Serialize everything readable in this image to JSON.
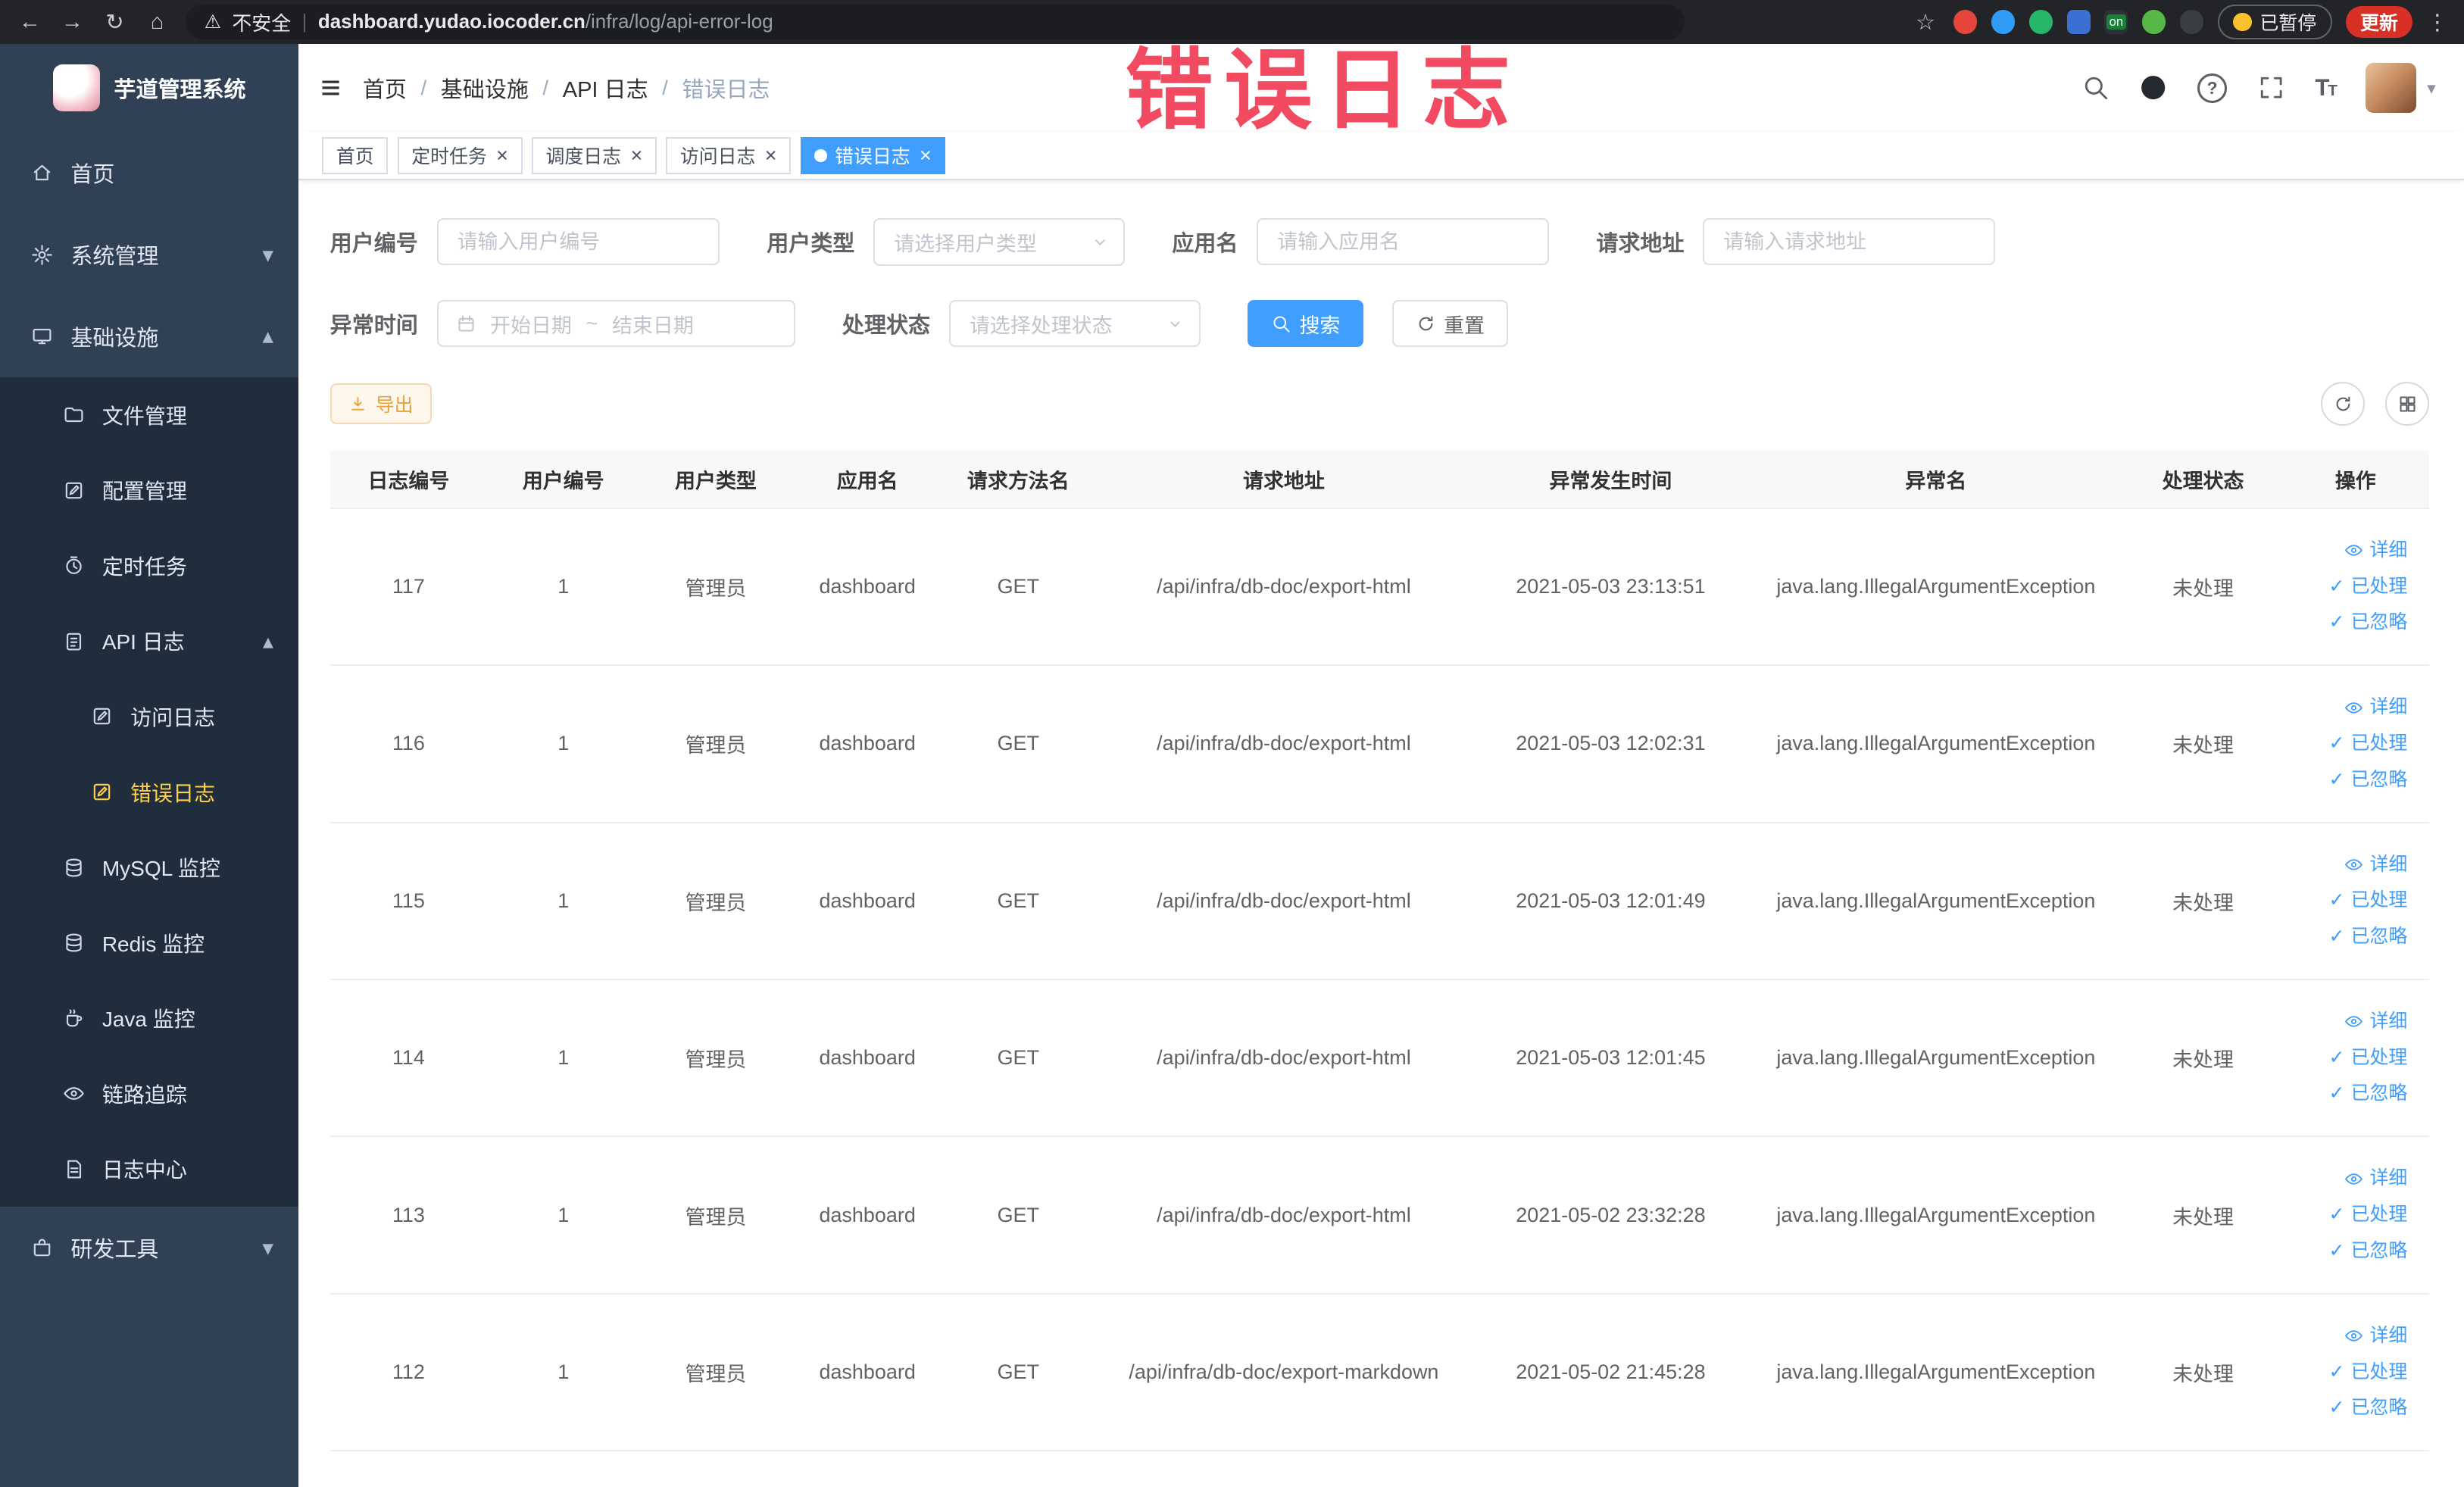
{
  "annotation": {
    "text": "错误日志"
  },
  "glyphs": {
    "back": "←",
    "forward": "→",
    "reload": "↻",
    "home": "⌂",
    "warning": "⚠",
    "star": "☆",
    "hamburger": "≡",
    "check": "✓",
    "close": "×",
    "menu_dots": "⋮",
    "pipe": "|",
    "crumb_sep": "/",
    "caret_down": "▾",
    "caret_up": "▴"
  },
  "browser": {
    "security_label": "不安全",
    "url_domain": "dashboard.yudao.iocoder.cn",
    "url_path": "/infra/log/api-error-log",
    "extension_badge": "on",
    "paused_label": "已暂停",
    "update_label": "更新"
  },
  "sidebar": {
    "logo_title": "芋道管理系统",
    "items": [
      {
        "label": "首页"
      },
      {
        "label": "系统管理"
      },
      {
        "label": "基础设施"
      },
      {
        "label": "文件管理"
      },
      {
        "label": "配置管理"
      },
      {
        "label": "定时任务"
      },
      {
        "label": "API 日志"
      },
      {
        "label": "访问日志"
      },
      {
        "label": "错误日志"
      },
      {
        "label": "MySQL 监控"
      },
      {
        "label": "Redis 监控"
      },
      {
        "label": "Java 监控"
      },
      {
        "label": "链路追踪"
      },
      {
        "label": "日志中心"
      },
      {
        "label": "研发工具"
      }
    ]
  },
  "header": {
    "breadcrumb": [
      "首页",
      "基础设施",
      "API 日志",
      "错误日志"
    ]
  },
  "tabs": [
    {
      "label": "首页"
    },
    {
      "label": "定时任务"
    },
    {
      "label": "调度日志"
    },
    {
      "label": "访问日志"
    },
    {
      "label": "错误日志"
    }
  ],
  "filters": {
    "user_id": {
      "label": "用户编号",
      "placeholder": "请输入用户编号"
    },
    "user_type": {
      "label": "用户类型",
      "placeholder": "请选择用户类型"
    },
    "app_name": {
      "label": "应用名",
      "placeholder": "请输入应用名"
    },
    "request_url": {
      "label": "请求地址",
      "placeholder": "请输入请求地址"
    },
    "exception_time": {
      "label": "异常时间",
      "start_placeholder": "开始日期",
      "separator": "~",
      "end_placeholder": "结束日期"
    },
    "process_status": {
      "label": "处理状态",
      "placeholder": "请选择处理状态"
    },
    "search_label": "搜索",
    "reset_label": "重置"
  },
  "toolbar": {
    "export_label": "导出"
  },
  "table": {
    "headers": [
      "日志编号",
      "用户编号",
      "用户类型",
      "应用名",
      "请求方法名",
      "请求地址",
      "异常发生时间",
      "异常名",
      "处理状态",
      "操作"
    ],
    "actions": {
      "detail": "详细",
      "processed": "已处理",
      "ignored": "已忽略"
    },
    "rows": [
      {
        "id": "117",
        "user_id": "1",
        "user_type": "管理员",
        "app": "dashboard",
        "method": "GET",
        "url": "/api/infra/db-doc/export-html",
        "time": "2021-05-03 23:13:51",
        "exception": "java.lang.IllegalArgumentException",
        "status": "未处理"
      },
      {
        "id": "116",
        "user_id": "1",
        "user_type": "管理员",
        "app": "dashboard",
        "method": "GET",
        "url": "/api/infra/db-doc/export-html",
        "time": "2021-05-03 12:02:31",
        "exception": "java.lang.IllegalArgumentException",
        "status": "未处理"
      },
      {
        "id": "115",
        "user_id": "1",
        "user_type": "管理员",
        "app": "dashboard",
        "method": "GET",
        "url": "/api/infra/db-doc/export-html",
        "time": "2021-05-03 12:01:49",
        "exception": "java.lang.IllegalArgumentException",
        "status": "未处理"
      },
      {
        "id": "114",
        "user_id": "1",
        "user_type": "管理员",
        "app": "dashboard",
        "method": "GET",
        "url": "/api/infra/db-doc/export-html",
        "time": "2021-05-03 12:01:45",
        "exception": "java.lang.IllegalArgumentException",
        "status": "未处理"
      },
      {
        "id": "113",
        "user_id": "1",
        "user_type": "管理员",
        "app": "dashboard",
        "method": "GET",
        "url": "/api/infra/db-doc/export-html",
        "time": "2021-05-02 23:32:28",
        "exception": "java.lang.IllegalArgumentException",
        "status": "未处理"
      },
      {
        "id": "112",
        "user_id": "1",
        "user_type": "管理员",
        "app": "dashboard",
        "method": "GET",
        "url": "/api/infra/db-doc/export-markdown",
        "time": "2021-05-02 21:45:28",
        "exception": "java.lang.IllegalArgumentException",
        "status": "未处理"
      }
    ]
  },
  "colors": {
    "primary": "#409EFF",
    "warning_text": "#e6a23c",
    "warning_bg": "#fdf6ec",
    "sidebar_bg": "#304156",
    "submenu_bg": "#1f2d3d",
    "active_menu_text": "#ffd04b",
    "annotation_red": "#f23e56",
    "update_button_red": "#d93025",
    "browser_bar_bg": "#232428"
  }
}
